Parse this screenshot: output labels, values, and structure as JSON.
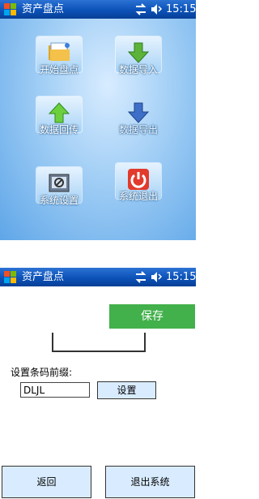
{
  "window1": {
    "title": "资产盘点",
    "clock": "15:15"
  },
  "menu": {
    "tiles": [
      {
        "label": "开始盘点",
        "icon": "folder-icon"
      },
      {
        "label": "数据导入",
        "icon": "download-arrow-icon"
      },
      {
        "label": "数据回传",
        "icon": "upload-arrow-icon"
      },
      {
        "label": "数据导出",
        "icon": "export-arrow-icon"
      },
      {
        "label": "系统设置",
        "icon": "settings-icon"
      },
      {
        "label": "系统退出",
        "icon": "power-icon"
      }
    ]
  },
  "window2": {
    "title": "资产盘点",
    "clock": "15:15"
  },
  "settings": {
    "save_label": "保存",
    "prefix_label": "设置条码前缀:",
    "prefix_value": "DLJL",
    "set_label": "设置",
    "back_label": "返回",
    "exit_label": "退出系统"
  },
  "colors": {
    "titlebar": "#0c52b8",
    "save_button": "#42b04b",
    "button_bg": "#d9ecff"
  }
}
